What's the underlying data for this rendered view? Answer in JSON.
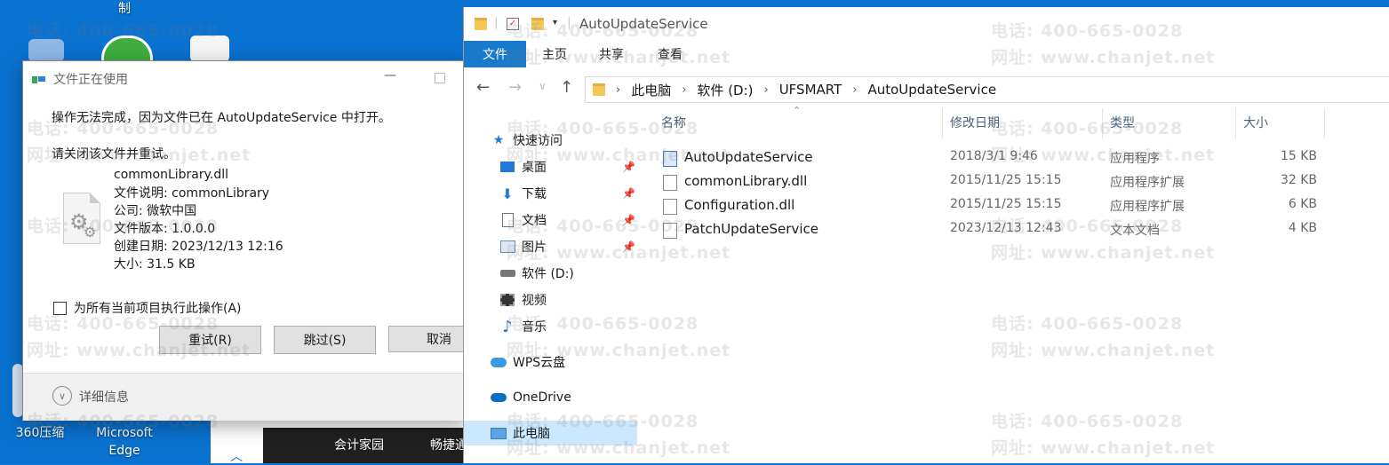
{
  "desktop": {
    "top_label": "制",
    "icons": [
      {
        "label": "360压缩"
      },
      {
        "label": "Microsoft\nEdge"
      }
    ],
    "taskbar_items": [
      "会计家园",
      "畅捷通"
    ]
  },
  "watermark": {
    "phone": "电话: 400-665-0028",
    "url": "网址: www.chanjet.net"
  },
  "dialog": {
    "title": "文件正在使用",
    "message": "操作无法完成，因为文件已在 AutoUpdateService 中打开。",
    "instruction": "请关闭该文件并重试。",
    "file": {
      "name": "commonLibrary.dll",
      "description": "文件说明: commonLibrary",
      "company": "公司: 微软中国",
      "version": "文件版本: 1.0.0.0",
      "created": "创建日期: 2023/12/13 12:16",
      "size": "大小: 31.5 KB"
    },
    "checkbox_label": "为所有当前项目执行此操作(A)",
    "buttons": {
      "retry": "重试(R)",
      "skip": "跳过(S)",
      "cancel": "取消"
    },
    "details_label": "详细信息"
  },
  "explorer": {
    "title": "AutoUpdateService",
    "ribbon_tabs": [
      "文件",
      "主页",
      "共享",
      "查看"
    ],
    "breadcrumb": [
      "此电脑",
      "软件 (D:)",
      "UFSMART",
      "AutoUpdateService"
    ],
    "columns": {
      "name": "名称",
      "modified": "修改日期",
      "type": "类型",
      "size": "大小"
    },
    "nav": [
      {
        "label": "快速访问",
        "icon": "star-icon"
      },
      {
        "label": "桌面",
        "icon": "desktop-icon",
        "pinned": true
      },
      {
        "label": "下载",
        "icon": "download-icon",
        "pinned": true
      },
      {
        "label": "文档",
        "icon": "document-icon",
        "pinned": true
      },
      {
        "label": "图片",
        "icon": "picture-icon",
        "pinned": true
      },
      {
        "label": "软件 (D:)",
        "icon": "drive-icon"
      },
      {
        "label": "视频",
        "icon": "video-icon"
      },
      {
        "label": "音乐",
        "icon": "music-icon"
      },
      {
        "label": "WPS云盘",
        "icon": "cloud-icon"
      },
      {
        "label": "OneDrive",
        "icon": "onedrive-icon"
      },
      {
        "label": "此电脑",
        "icon": "computer-icon"
      }
    ],
    "files": [
      {
        "name": "AutoUpdateService",
        "modified": "2018/3/1 9:46",
        "type": "应用程序",
        "size": "15 KB"
      },
      {
        "name": "commonLibrary.dll",
        "modified": "2015/11/25 15:15",
        "type": "应用程序扩展",
        "size": "32 KB"
      },
      {
        "name": "Configuration.dll",
        "modified": "2015/11/25 15:15",
        "type": "应用程序扩展",
        "size": "6 KB"
      },
      {
        "name": "PatchUpdateService",
        "modified": "2023/12/13 12:43",
        "type": "文本文档",
        "size": "4 KB"
      }
    ]
  }
}
